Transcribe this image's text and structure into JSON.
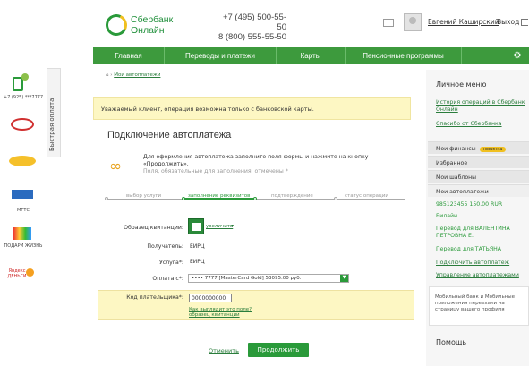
{
  "header": {
    "logo_line1": "Сбербанк",
    "logo_line2": "Онлайн",
    "phone1": "+7 (495) 500-55-50",
    "phone2": "8 (800) 555-55-50",
    "username": "Евгений Каширский",
    "exit": "Выход"
  },
  "nav": {
    "items": [
      "Главная",
      "Переводы и платежи",
      "Карты",
      "Пенсионные программы"
    ]
  },
  "quick_pay": {
    "label": "Быстрая оплата",
    "phone": "+7 (925) ***7777",
    "items": [
      "МГТС",
      "ПОДАРИ ЖИЗНЬ",
      "Яндекс ДЕНЬГИ"
    ]
  },
  "breadcrumb": "Мои автоплатежи",
  "notice": "Уважаемый клиент, операция возможна только с банковской карты.",
  "page_title": "Подключение автоплатежа",
  "instructions": {
    "text": "Для оформления автоплатежа заполните поля формы и нажмите на кнопку «Продолжить».",
    "sub": "Поля, обязательные для заполнения, отмечены *"
  },
  "steps": [
    "выбор услуги",
    "заполнение реквизитов",
    "подтверждение",
    "статус операции"
  ],
  "form": {
    "receipt_label": "Образец квитанции:",
    "receipt_link": "увеличить",
    "recipient_label": "Получатель:",
    "recipient": "ЕИРЦ",
    "service_label": "Услуга*:",
    "service": "ЕИРЦ",
    "pay_from_label": "Оплата с*:",
    "pay_from": "•••• 7777 [MasterCard Gold] 53095.00 руб.",
    "payer_code_label": "Код плательщика*:",
    "payer_code": "0000000000",
    "hint": "Как выглядит это поле?",
    "hint2": "образец квитанции"
  },
  "buttons": {
    "cancel": "Отменить",
    "continue": "Продолжить"
  },
  "sidebar": {
    "personal": "Личное меню",
    "links": [
      "История операций в Сбербанк Онлайн",
      "Спасибо от Сбербанка"
    ],
    "finance": "Мои финансы",
    "finance_badge": "новинка",
    "favorites": "Избранное",
    "templates": "Мои шаблоны",
    "autopay": "Мои автоплатежи",
    "auto_items": [
      "985123455 150.00 RUR",
      "Билайн",
      "Перевод для ВАЛЕНТИНА ПЕТРОВНА Е.",
      "Перевод для ТАТЬЯНА",
      "Подключить автоплатеж",
      "Управление автоплатежами"
    ],
    "promo": "Мобильный банк и Мобильные приложения переехали на страницу вашего профиля",
    "help": "Помощь"
  },
  "colors": {
    "brand_green": "#2a9a3a",
    "notice_bg": "#fdf7c3",
    "accent_yellow": "#f0c020"
  }
}
